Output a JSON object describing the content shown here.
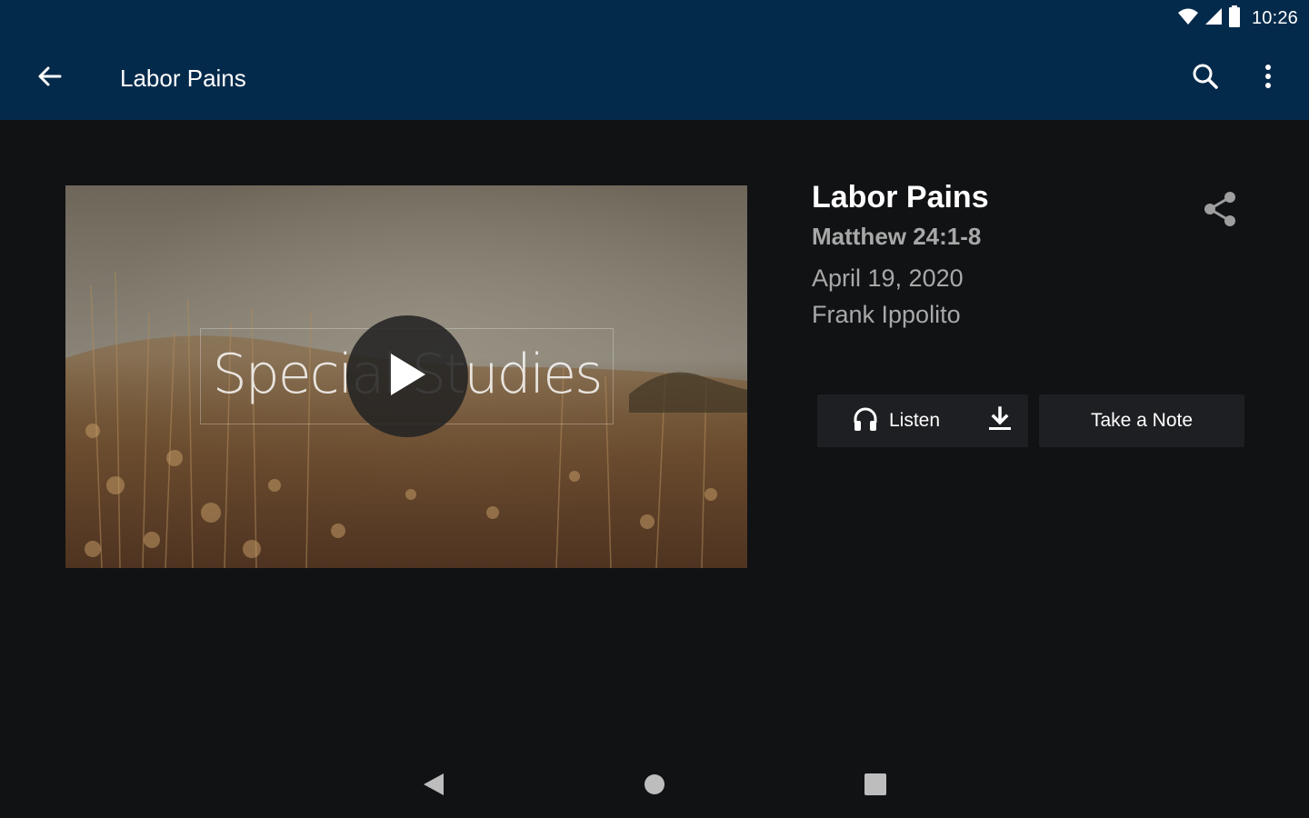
{
  "status_bar": {
    "time": "10:26",
    "icons": [
      "wifi-icon",
      "cellular-signal-icon",
      "battery-icon"
    ]
  },
  "app_bar": {
    "title": "Labor Pains",
    "back_icon": "arrow-back-icon",
    "search_icon": "search-icon",
    "more_icon": "more-vert-icon",
    "background_color": "#042a4b"
  },
  "video": {
    "overlay_text": "Special Studies",
    "play_icon": "play-icon"
  },
  "sermon": {
    "title": "Labor Pains",
    "reference": "Matthew 24:1-8",
    "date": "April 19, 2020",
    "speaker": "Frank Ippolito",
    "share_icon": "share-icon"
  },
  "actions": {
    "listen_label": "Listen",
    "listen_icon": "headphones-icon",
    "download_icon": "download-icon",
    "note_label": "Take a Note"
  },
  "nav_bar": {
    "icons": [
      "nav-back-icon",
      "nav-home-icon",
      "nav-recents-icon"
    ]
  },
  "colors": {
    "background": "#111214",
    "button_background": "#1e1f22",
    "secondary_text": "#a8a8a8"
  }
}
